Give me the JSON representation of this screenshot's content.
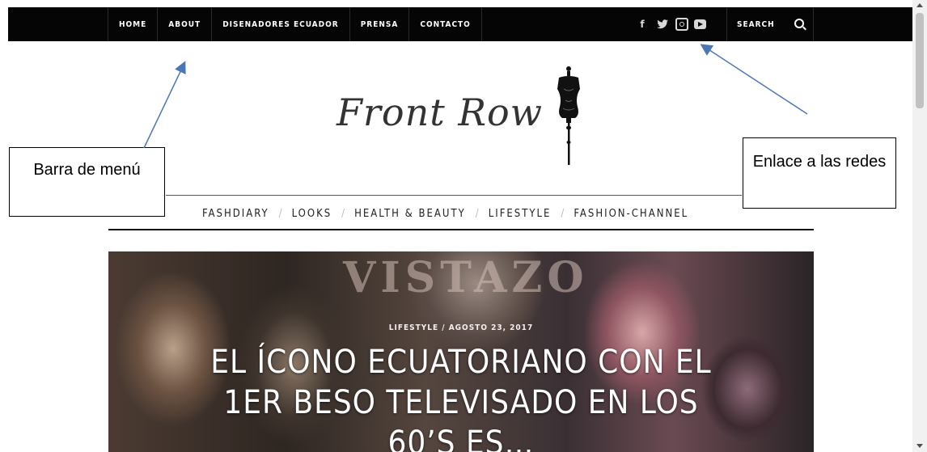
{
  "topbar": {
    "menu": [
      "HOME",
      "ABOUT",
      "DISENADORES ECUADOR",
      "PRENSA",
      "CONTACTO"
    ],
    "social_icons": [
      "facebook-icon",
      "twitter-icon",
      "instagram-icon",
      "youtube-icon"
    ],
    "search_label": "SEARCH"
  },
  "logo": {
    "text": "Front Row"
  },
  "category_nav": {
    "items": [
      "FASHDIARY",
      "LOOKS",
      "HEALTH & BEAUTY",
      "LIFESTYLE",
      "FASHION-CHANNEL"
    ]
  },
  "hero": {
    "magazine_text": "VISTAZO",
    "meta": "LIFESTYLE / AGOSTO 23, 2017",
    "title": "EL ÍCONO ECUATORIANO CON EL 1ER BESO TELEVISADO EN LOS 60’S ES…"
  },
  "annotations": {
    "menu_callout": "Barra de menú",
    "redes_callout": "Enlace a las redes"
  },
  "colors": {
    "topbar": "#050505",
    "annotation_arrow": "#4a78b5"
  }
}
